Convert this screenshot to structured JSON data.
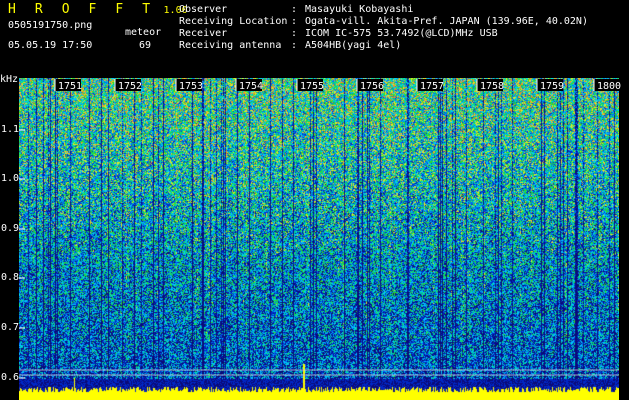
{
  "header": {
    "app_name": "H R O F F T",
    "version": "1.00",
    "filename": "0505191750.png",
    "datetime": "05.05.19 17:50",
    "event_type": "meteor",
    "event_count": "69"
  },
  "info": [
    {
      "label": "Observer",
      "value": "Masayuki Kobayashi"
    },
    {
      "label": "Receiving Location",
      "value": "Ogata-vill. Akita-Pref. JAPAN (139.96E, 40.02N)"
    },
    {
      "label": "Receiver",
      "value": "ICOM IC-575 53.7492(@LCD)MHz USB"
    },
    {
      "label": "Receiving antenna",
      "value": "A504HB(yagi 4el)"
    }
  ],
  "axis": {
    "unit": "kHz",
    "y_ticks": [
      "1.1",
      "1.0",
      "0.9",
      "0.8",
      "0.7",
      "0.6"
    ],
    "time_ticks": [
      "1751",
      "1752",
      "1753",
      "1754",
      "1755",
      "1756",
      "1757",
      "1758",
      "1759",
      "1800"
    ]
  },
  "colors": {
    "label_yellow": "#ffff00",
    "text_white": "#ffffff",
    "background": "#000000"
  }
}
